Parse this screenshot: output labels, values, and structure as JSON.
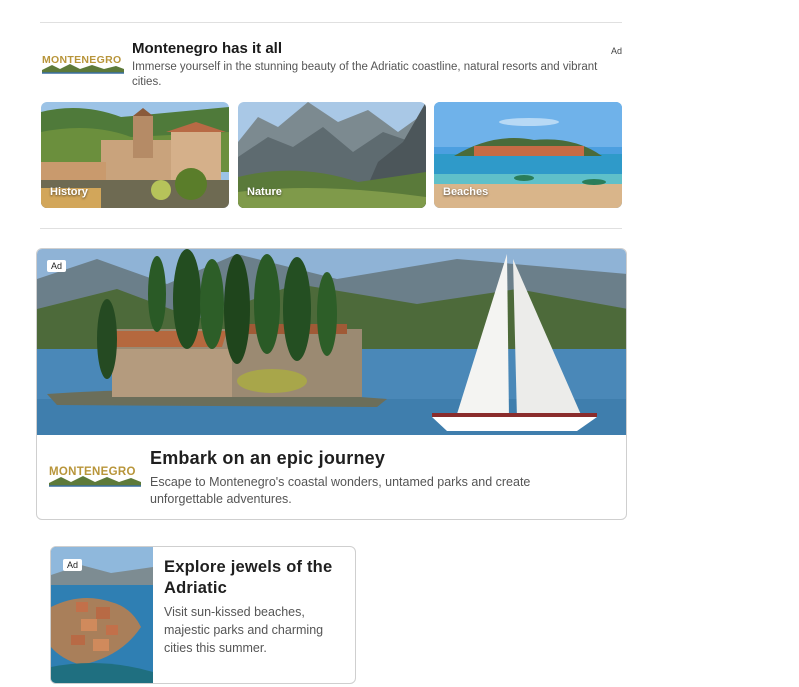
{
  "ad1": {
    "logo_text": "MONTENEGRO",
    "title": "Montenegro has it all",
    "description": "Immerse yourself in the stunning beauty of the Adriatic coastline, natural resorts and vibrant cities.",
    "ad_label": "Ad",
    "tiles": [
      {
        "label": "History"
      },
      {
        "label": "Nature"
      },
      {
        "label": "Beaches"
      }
    ]
  },
  "ad2": {
    "ad_label": "Ad",
    "logo_text": "MONTENEGRO",
    "title": "Embark on an epic journey",
    "description": "Escape to Montenegro's coastal wonders, untamed parks and create unforgettable adventures."
  },
  "ad3": {
    "ad_label": "Ad",
    "title": "Explore jewels of the Adriatic",
    "description": "Visit sun-kissed beaches, majestic parks and charming cities this summer."
  },
  "colors": {
    "text_primary": "#1a1a1a",
    "text_secondary": "#555555",
    "border": "#cfcfcf",
    "sea": "#3f8fc4",
    "sky": "#7fb7e6"
  }
}
